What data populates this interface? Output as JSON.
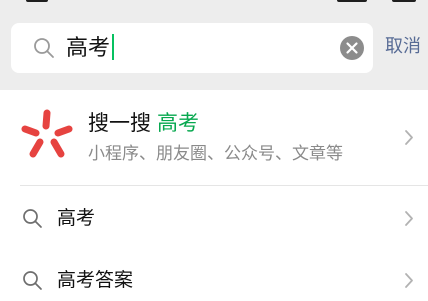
{
  "search": {
    "query": "高考",
    "cancel_label": "取消"
  },
  "results": {
    "sou_yi_sou": {
      "title": "搜一搜",
      "keyword": "高考",
      "subtitle": "小程序、朋友圈、公众号、文章等",
      "logo_icon": "sou-yi-sou-logo",
      "logo_color": "#e64340"
    },
    "suggestions": [
      {
        "label": "高考"
      },
      {
        "label": "高考答案"
      }
    ]
  },
  "colors": {
    "accent_green": "#07c160",
    "link_blue": "#576b95",
    "background": "#ededed"
  }
}
